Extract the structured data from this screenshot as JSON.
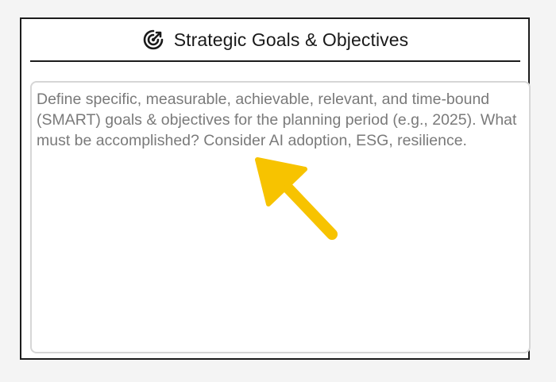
{
  "card": {
    "title": "Strategic Goals & Objectives",
    "title_icon": "target-refresh-icon"
  },
  "goals_field": {
    "value": "",
    "placeholder": "Define specific, measurable, achievable, relevant, and time-bound (SMART) goals & objectives for the planning period (e.g., 2025). What must be accomplished? Consider AI adoption, ESG, resilience."
  },
  "colors": {
    "arrow": "#f7c300",
    "border": "#1c1c1c",
    "field_border": "#d6d6d6",
    "placeholder": "#7a7a7a"
  }
}
